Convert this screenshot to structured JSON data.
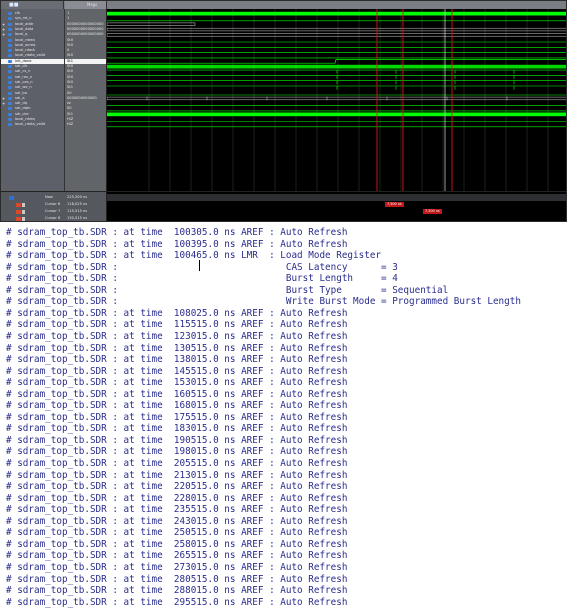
{
  "wave_window": {
    "header_title": "Msgs",
    "signals": [
      {
        "name": "clk",
        "value": "1"
      },
      {
        "name": "sys_rst_n",
        "value": "1"
      },
      {
        "name": "local_addr",
        "value": "0000000000000000"
      },
      {
        "name": "local_data",
        "value": "0000000000000000"
      },
      {
        "name": "local_q",
        "value": "0000000000000000"
      },
      {
        "name": "local_rdreq",
        "value": "St0"
      },
      {
        "name": "local_wrreq",
        "value": "St0"
      },
      {
        "name": "local_rdack",
        "value": "0"
      },
      {
        "name": "local_rdata_valid",
        "value": "St0"
      },
      {
        "name": "init_done",
        "value": "St1"
      },
      {
        "name": "sdr_clk",
        "value": "St0"
      },
      {
        "name": "sdr_cs_n",
        "value": "St0"
      },
      {
        "name": "sdr_ras_n",
        "value": "St0"
      },
      {
        "name": "sdr_cas_n",
        "value": "St0"
      },
      {
        "name": "sdr_we_n",
        "value": "St1"
      },
      {
        "name": "sdr_ba",
        "value": "00"
      },
      {
        "name": "sdr_a",
        "value": "0000000000000"
      },
      {
        "name": "sdr_dq",
        "value": "zz"
      },
      {
        "name": "sdr_dqm",
        "value": "00"
      },
      {
        "name": "sdr_cke",
        "value": "St1"
      },
      {
        "name": "local_rdreq",
        "value": "HiZ"
      },
      {
        "name": "local_rdata_valid",
        "value": "HiZ"
      }
    ],
    "cursors": [
      {
        "label": "Now",
        "value": "225,300 ns"
      },
      {
        "label": "Cursor 6",
        "value": "118,025 ns"
      },
      {
        "label": "Cursor 7",
        "value": "115,515 ns"
      },
      {
        "label": "Cursor 8",
        "value": "130,515 ns"
      }
    ],
    "delta_labels": [
      "7,500 ns",
      "7,500 ns"
    ],
    "colors": {
      "wave": "#00ff00",
      "bus_fill": "#cfcfcf",
      "cursor": "#e0141a",
      "grid": "#2d4a2d"
    }
  },
  "transcript": {
    "lines": [
      "# sdram_top_tb.SDR : at time  100305.0 ns AREF : Auto Refresh",
      "# sdram_top_tb.SDR : at time  100395.0 ns AREF : Auto Refresh",
      "# sdram_top_tb.SDR : at time  100465.0 ns LMR  : Load Mode Register",
      "# sdram_top_tb.SDR :                              CAS Latency      = 3",
      "# sdram_top_tb.SDR :                              Burst Length     = 4",
      "# sdram_top_tb.SDR :                              Burst Type       = Sequential",
      "# sdram_top_tb.SDR :                              Write Burst Mode = Programmed Burst Length",
      "# sdram_top_tb.SDR : at time  108025.0 ns AREF : Auto Refresh",
      "# sdram_top_tb.SDR : at time  115515.0 ns AREF : Auto Refresh",
      "# sdram_top_tb.SDR : at time  123015.0 ns AREF : Auto Refresh",
      "# sdram_top_tb.SDR : at time  130515.0 ns AREF : Auto Refresh",
      "# sdram_top_tb.SDR : at time  138015.0 ns AREF : Auto Refresh",
      "# sdram_top_tb.SDR : at time  145515.0 ns AREF : Auto Refresh",
      "# sdram_top_tb.SDR : at time  153015.0 ns AREF : Auto Refresh",
      "# sdram_top_tb.SDR : at time  160515.0 ns AREF : Auto Refresh",
      "# sdram_top_tb.SDR : at time  168015.0 ns AREF : Auto Refresh",
      "# sdram_top_tb.SDR : at time  175515.0 ns AREF : Auto Refresh",
      "# sdram_top_tb.SDR : at time  183015.0 ns AREF : Auto Refresh",
      "# sdram_top_tb.SDR : at time  190515.0 ns AREF : Auto Refresh",
      "# sdram_top_tb.SDR : at time  198015.0 ns AREF : Auto Refresh",
      "# sdram_top_tb.SDR : at time  205515.0 ns AREF : Auto Refresh",
      "# sdram_top_tb.SDR : at time  213015.0 ns AREF : Auto Refresh",
      "# sdram_top_tb.SDR : at time  220515.0 ns AREF : Auto Refresh",
      "# sdram_top_tb.SDR : at time  228015.0 ns AREF : Auto Refresh",
      "# sdram_top_tb.SDR : at time  235515.0 ns AREF : Auto Refresh",
      "# sdram_top_tb.SDR : at time  243015.0 ns AREF : Auto Refresh",
      "# sdram_top_tb.SDR : at time  250515.0 ns AREF : Auto Refresh",
      "# sdram_top_tb.SDR : at time  258015.0 ns AREF : Auto Refresh",
      "# sdram_top_tb.SDR : at time  265515.0 ns AREF : Auto Refresh",
      "# sdram_top_tb.SDR : at time  273015.0 ns AREF : Auto Refresh",
      "# sdram_top_tb.SDR : at time  280515.0 ns AREF : Auto Refresh",
      "# sdram_top_tb.SDR : at time  288015.0 ns AREF : Auto Refresh",
      "# sdram_top_tb.SDR : at time  295515.0 ns AREF : Auto Refresh"
    ]
  }
}
